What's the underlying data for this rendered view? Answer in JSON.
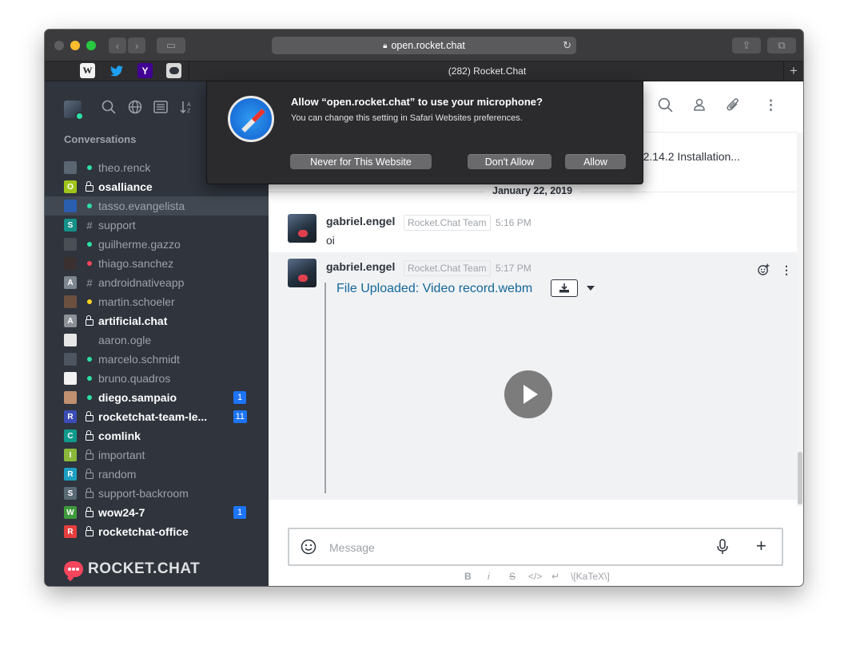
{
  "browser": {
    "url": "open.rocket.chat",
    "tab_title": "(282) Rocket.Chat",
    "favorites": [
      "apple-icon",
      "wikipedia-icon",
      "twitter-icon",
      "yahoo-icon",
      "rocketchat-icon"
    ],
    "favorite_labels": {
      "wikipedia": "W",
      "yahoo": "Y"
    }
  },
  "permission_dialog": {
    "title": "Allow “open.rocket.chat” to use your microphone?",
    "subtitle": "You can change this setting in Safari Websites preferences.",
    "never_label": "Never for This Website",
    "dont_allow_label": "Don't Allow",
    "allow_label": "Allow"
  },
  "sidebar": {
    "section_title": "Conversations",
    "rooms": [
      {
        "name": "theo.renck",
        "kind": "dm",
        "status": "#2de0a5",
        "bold": false,
        "avatar_color": "#5b6673",
        "letter": ""
      },
      {
        "name": "osalliance",
        "kind": "private",
        "bold": true,
        "avatar_color": "#a0c51a",
        "letter": "O"
      },
      {
        "name": "tasso.evangelista",
        "kind": "dm",
        "status": "#2de0a5",
        "bold": false,
        "avatar_color": "#2a5fb0",
        "letter": "",
        "active": true
      },
      {
        "name": "support",
        "kind": "channel",
        "bold": false,
        "avatar_color": "#159088",
        "letter": "S"
      },
      {
        "name": "guilherme.gazzo",
        "kind": "dm",
        "status": "#2de0a5",
        "bold": false,
        "avatar_color": "#4a4f56",
        "letter": ""
      },
      {
        "name": "thiago.sanchez",
        "kind": "dm",
        "status": "#f5455c",
        "bold": false,
        "avatar_color": "#3a3030",
        "letter": ""
      },
      {
        "name": "androidnativeapp",
        "kind": "channel",
        "bold": false,
        "avatar_color": "#7e8690",
        "letter": "A"
      },
      {
        "name": "martin.schoeler",
        "kind": "dm",
        "status": "#ffd21f",
        "bold": false,
        "avatar_color": "#6b5040",
        "letter": ""
      },
      {
        "name": "artificial.chat",
        "kind": "private",
        "bold": true,
        "avatar_color": "#8c9097",
        "letter": "A"
      },
      {
        "name": "aaron.ogle",
        "kind": "dm",
        "status": "#2f343d",
        "bold": false,
        "avatar_color": "#e7e7e7",
        "letter": ""
      },
      {
        "name": "marcelo.schmidt",
        "kind": "dm",
        "status": "#2de0a5",
        "bold": false,
        "avatar_color": "#4c5560",
        "letter": ""
      },
      {
        "name": "bruno.quadros",
        "kind": "dm",
        "status": "#2de0a5",
        "bold": false,
        "avatar_color": "#f2f2f2",
        "letter": ""
      },
      {
        "name": "diego.sampaio",
        "kind": "dm",
        "status": "#2de0a5",
        "bold": true,
        "avatar_color": "#c09070",
        "letter": "",
        "badge": "1"
      },
      {
        "name": "rocketchat-team-le...",
        "kind": "private",
        "bold": true,
        "avatar_color": "#3b4cb5",
        "letter": "R",
        "badge": "11"
      },
      {
        "name": "comlink",
        "kind": "private",
        "bold": true,
        "avatar_color": "#0f9a8c",
        "letter": "C"
      },
      {
        "name": "important",
        "kind": "private",
        "bold": false,
        "avatar_color": "#8ab83a",
        "letter": "I"
      },
      {
        "name": "random",
        "kind": "private",
        "bold": false,
        "avatar_color": "#1e9fc2",
        "letter": "R"
      },
      {
        "name": "support-backroom",
        "kind": "private",
        "bold": false,
        "avatar_color": "#5a6a75",
        "letter": "S"
      },
      {
        "name": "wow24-7",
        "kind": "private",
        "bold": true,
        "avatar_color": "#3f9b3c",
        "letter": "W",
        "badge": "1"
      },
      {
        "name": "rocketchat-office",
        "kind": "private",
        "bold": true,
        "avatar_color": "#e53e3e",
        "letter": "R"
      }
    ],
    "logo_text": "ROCKET.CHAT"
  },
  "main": {
    "previous_text": "n: 2.14.2 Installation...",
    "date_separator": "January 22, 2019",
    "messages": [
      {
        "user": "gabriel.engel",
        "role": "Rocket.Chat Team",
        "time": "5:16 PM",
        "text": "oi"
      },
      {
        "user": "gabriel.engel",
        "role": "Rocket.Chat Team",
        "time": "5:17 PM",
        "attachment_title": "File Uploaded: Video record.webm"
      }
    ],
    "composer_placeholder": "Message",
    "format_hints": {
      "bold": "B",
      "italic": "i",
      "strike": "S",
      "katex": "\\[KaTeX\\]"
    }
  }
}
